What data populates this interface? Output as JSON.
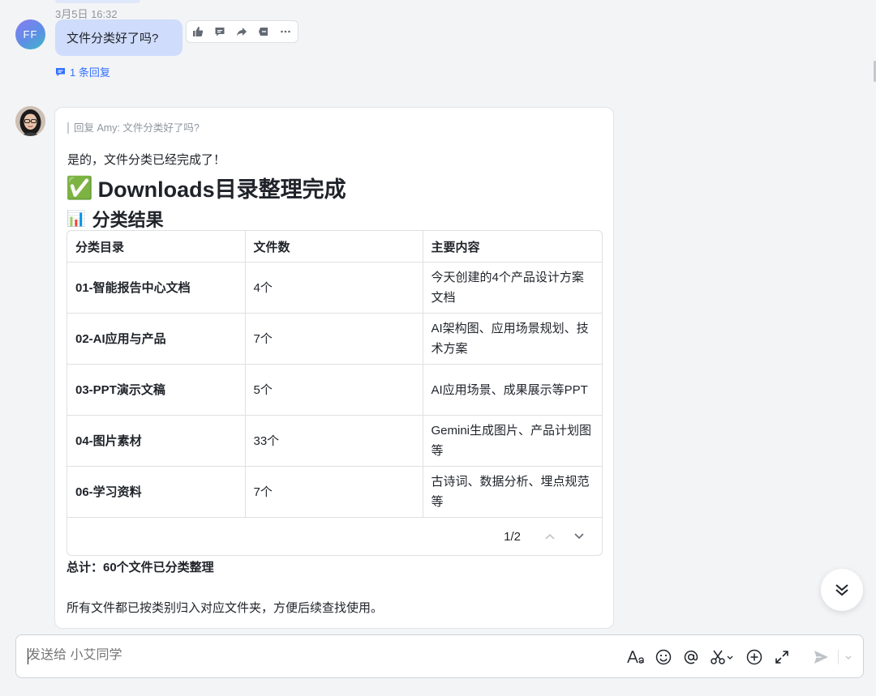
{
  "message_prev": {
    "timestamp": "3月5日 16:32",
    "avatar_initials": "FF",
    "text": "文件分类好了吗?",
    "reply_count": "1 条回复",
    "toolbar": [
      "thumbs-up-icon",
      "comment-icon",
      "forward-icon",
      "pin-icon",
      "more-icon"
    ]
  },
  "reply": {
    "quote": "回复 Amy: 文件分类好了吗?",
    "intro": "是的，文件分类已经完成了！",
    "heading_emoji": "✅",
    "heading": "Downloads目录整理完成",
    "subheading_emoji": "📊",
    "subheading": "分类结果",
    "table": {
      "headers": [
        "分类目录",
        "文件数",
        "主要内容"
      ],
      "rows": [
        [
          "01-智能报告中心文档",
          "4个",
          "今天创建的4个产品设计方案文档"
        ],
        [
          "02-AI应用与产品",
          "7个",
          "AI架构图、应用场景规划、技术方案"
        ],
        [
          "03-PPT演示文稿",
          "5个",
          "AI应用场景、成果展示等PPT"
        ],
        [
          "04-图片素材",
          "33个",
          "Gemini生成图片、产品计划图等"
        ],
        [
          "06-学习资料",
          "7个",
          "古诗词、数据分析、埋点规范等"
        ]
      ],
      "pager": "1/2"
    },
    "total": "总计：60个文件已分类整理",
    "closing": "所有文件都已按类别归入对应文件夹，方便后续查找使用。"
  },
  "composer": {
    "placeholder": "发送给 小艾同学",
    "tools": [
      "font-format-icon",
      "emoji-icon",
      "mention-icon",
      "screenshot-scissors-icon",
      "add-icon",
      "expand-icon",
      "send-icon",
      "send-options-chevron-icon"
    ]
  },
  "colors": {
    "accent": "#3370ff",
    "bubble": "#cfdcfb",
    "background": "#f3f4f6"
  }
}
